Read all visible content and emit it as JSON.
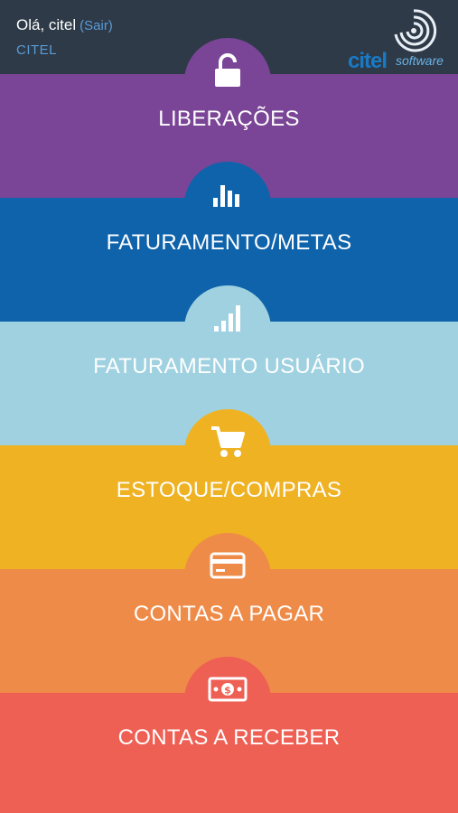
{
  "header": {
    "greeting": "Olá, citel",
    "logout_label": "(Sair)",
    "company": "CITEL",
    "logo_word": "citel",
    "logo_sub": "software"
  },
  "menu": [
    {
      "label": "LIBERAÇÕES",
      "icon": "unlock-icon",
      "color": "#7a4596"
    },
    {
      "label": "FATURAMENTO/METAS",
      "icon": "bar-chart-icon",
      "color": "#0f63ab"
    },
    {
      "label": "FATURAMENTO USUÁRIO",
      "icon": "signal-bars-icon",
      "color": "#9fd1e0"
    },
    {
      "label": "ESTOQUE/COMPRAS",
      "icon": "shopping-cart-icon",
      "color": "#efb223"
    },
    {
      "label": "CONTAS A PAGAR",
      "icon": "credit-card-icon",
      "color": "#ef8b48"
    },
    {
      "label": "CONTAS A RECEBER",
      "icon": "money-bill-icon",
      "color": "#ee5f54"
    }
  ],
  "colors": {
    "header_bg": "#2e3a48",
    "link": "#5b9bd5"
  }
}
